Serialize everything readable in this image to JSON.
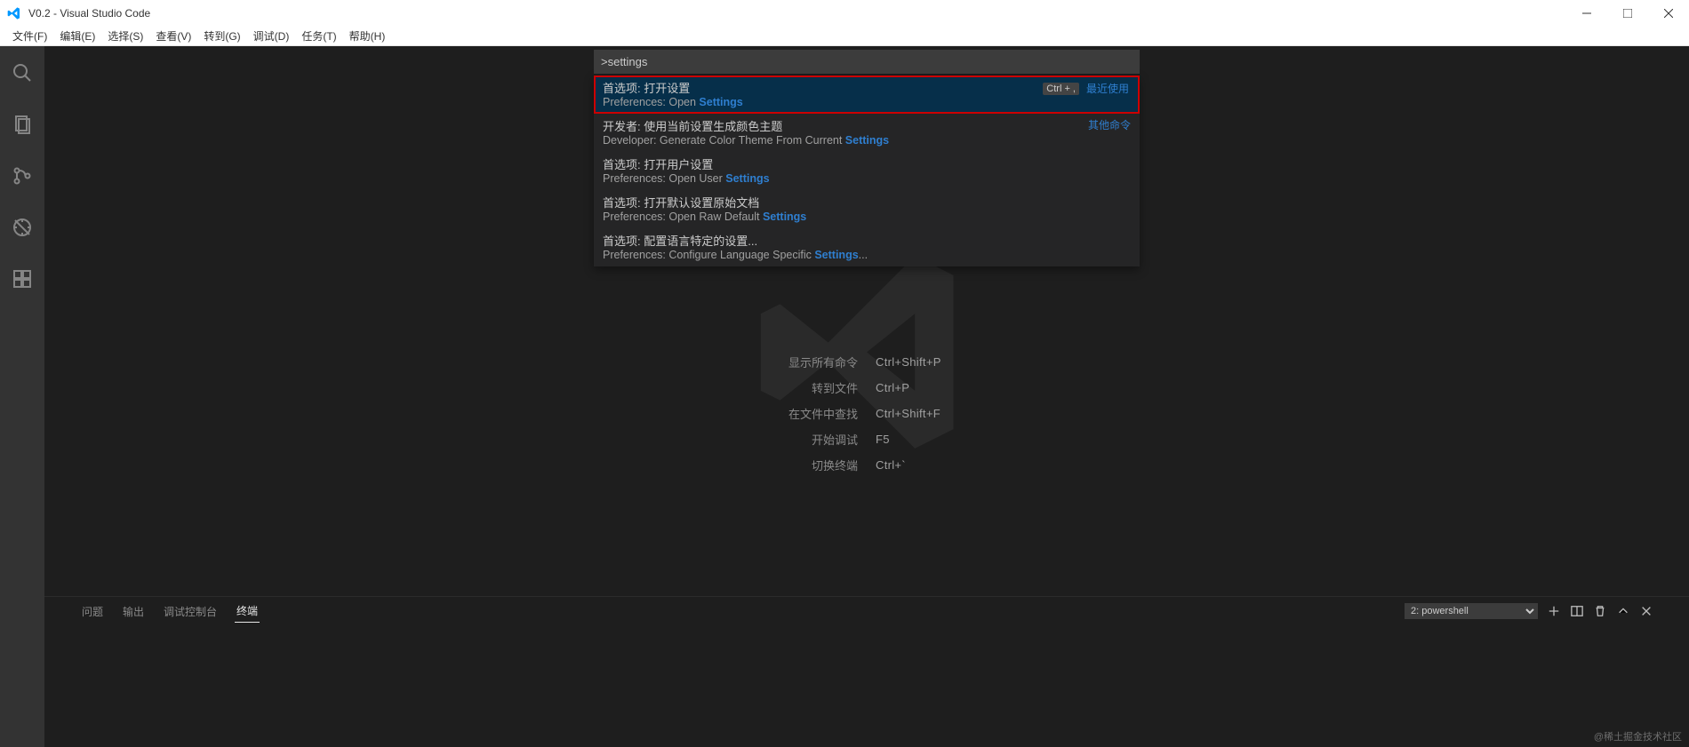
{
  "title": "V0.2 - Visual Studio Code",
  "menubar": [
    "文件(F)",
    "编辑(E)",
    "选择(S)",
    "查看(V)",
    "转到(G)",
    "调试(D)",
    "任务(T)",
    "帮助(H)"
  ],
  "quickinput": {
    "value": ">settings",
    "items": [
      {
        "zh": "首选项: 打开设置",
        "en_pre": "Preferences: Open ",
        "en_hl": "Settings",
        "en_post": "",
        "kbd": "Ctrl  +  ,",
        "tag": "最近使用",
        "selected": true
      },
      {
        "zh": "开发者: 使用当前设置生成颜色主题",
        "en_pre": "Developer: Generate Color Theme From Current ",
        "en_hl": "Settings",
        "en_post": "",
        "tag": "其他命令"
      },
      {
        "zh": "首选项: 打开用户设置",
        "en_pre": "Preferences: Open User ",
        "en_hl": "Settings",
        "en_post": ""
      },
      {
        "zh": "首选项: 打开默认设置原始文档",
        "en_pre": "Preferences: Open Raw Default ",
        "en_hl": "Settings",
        "en_post": ""
      },
      {
        "zh": "首选项: 配置语言特定的设置...",
        "en_pre": "Preferences: Configure Language Specific ",
        "en_hl": "Settings",
        "en_post": "..."
      }
    ]
  },
  "watermark": {
    "rows": [
      {
        "label": "显示所有命令",
        "key": "Ctrl+Shift+P"
      },
      {
        "label": "转到文件",
        "key": "Ctrl+P"
      },
      {
        "label": "在文件中查找",
        "key": "Ctrl+Shift+F"
      },
      {
        "label": "开始调试",
        "key": "F5"
      },
      {
        "label": "切换终端",
        "key": "Ctrl+`"
      }
    ]
  },
  "panel": {
    "tabs": [
      "问题",
      "输出",
      "调试控制台",
      "终端"
    ],
    "active_index": 3,
    "selector": "2: powershell"
  },
  "credit": "@稀土掘金技术社区"
}
